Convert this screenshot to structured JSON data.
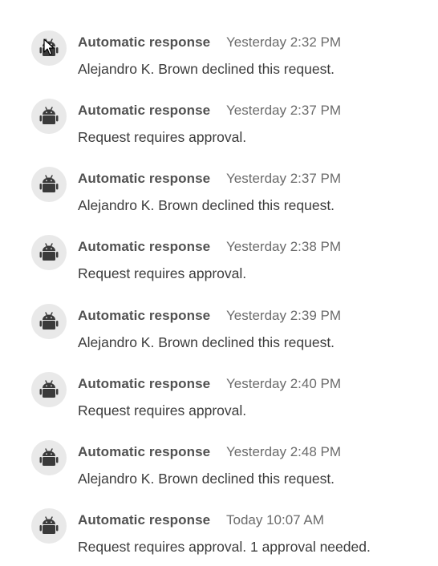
{
  "activity": {
    "entries": [
      {
        "author": "Automatic response",
        "time": "Yesterday 2:32 PM",
        "message": "Alejandro K. Brown declined this request."
      },
      {
        "author": "Automatic response",
        "time": "Yesterday 2:37 PM",
        "message": "Request requires approval."
      },
      {
        "author": "Automatic response",
        "time": "Yesterday 2:37 PM",
        "message": "Alejandro K. Brown declined this request."
      },
      {
        "author": "Automatic response",
        "time": "Yesterday 2:38 PM",
        "message": "Request requires approval."
      },
      {
        "author": "Automatic response",
        "time": "Yesterday 2:39 PM",
        "message": "Alejandro K. Brown declined this request."
      },
      {
        "author": "Automatic response",
        "time": "Yesterday 2:40 PM",
        "message": "Request requires approval."
      },
      {
        "author": "Automatic response",
        "time": "Yesterday 2:48 PM",
        "message": "Alejandro K. Brown declined this request."
      },
      {
        "author": "Automatic response",
        "time": "Today 10:07 AM",
        "message": "Request requires approval. 1 approval needed."
      }
    ]
  },
  "icons": {
    "avatar": "android-robot-icon",
    "cursor": "mouse-pointer-icon"
  },
  "colors": {
    "avatar_bg": "#e9e9e9",
    "robot": "#3a3a3a",
    "author_text": "#505050",
    "time_text": "#6b6b6b",
    "message_text": "#3c3c3c"
  }
}
